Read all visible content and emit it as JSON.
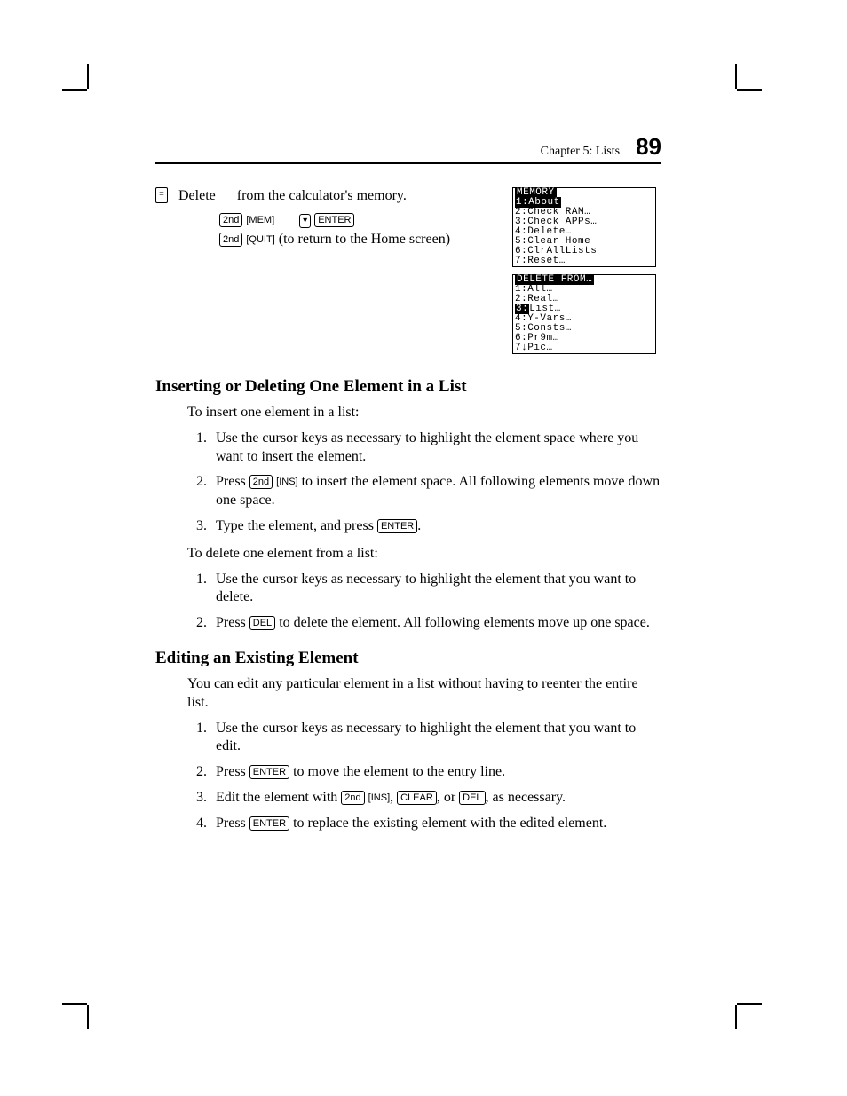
{
  "header": {
    "chapter": "Chapter 5: Lists",
    "page": "89"
  },
  "keys": {
    "second": "2nd",
    "mem": "MEM",
    "down": "▾",
    "enter": "ENTER",
    "quit": "QUIT",
    "ins": "INS",
    "del": "DEL",
    "clear": "CLEAR"
  },
  "topnote": {
    "text_a": "Delete",
    "text_b": "from the calculator's memory.",
    "line2_tail": " (to return to the Home screen)"
  },
  "screen1": {
    "title": "MEMORY",
    "lines": [
      "1:About",
      "2:Check RAM…",
      "3:Check APPs…",
      "4:Delete…",
      "5:Clear Home",
      "6:ClrAllLists",
      "7:Reset…"
    ],
    "sel_index": 0
  },
  "screen2": {
    "title": "DELETE FROM…",
    "lines": [
      "1:All…",
      "2:Real…",
      "3:List…",
      "4:Y-Vars…",
      "5:Consts…",
      "6:Pr9m…",
      "7↓Pic…"
    ],
    "sel_index": 2,
    "sel_label": "3:"
  },
  "h_insert": "Inserting or Deleting One Element in a List",
  "insert_lead": "To insert one element in a list:",
  "insert_steps": {
    "s1": "Use the cursor keys as necessary to highlight the element space where you want to insert the element.",
    "s2_a": "Press ",
    "s2_b": " to insert the element space. All following elements move down one space.",
    "s3_a": "Type the element, and press ",
    "s3_b": "."
  },
  "delete_lead": "To delete one element from a list:",
  "delete_steps": {
    "s1": "Use the cursor keys as necessary to highlight the element that you want to delete.",
    "s2_a": "Press ",
    "s2_b": " to delete the element. All following elements move up one space."
  },
  "h_edit": "Editing an Existing Element",
  "edit_lead": "You can edit any particular element in a list without having to reenter the entire list.",
  "edit_steps": {
    "s1": "Use the cursor keys as necessary to highlight the element that you want to edit.",
    "s2_a": "Press ",
    "s2_b": " to move the element to the entry line.",
    "s3_a": "Edit the element with ",
    "s3_mid": ", ",
    "s3_or": ", or ",
    "s3_b": ", as necessary.",
    "s4_a": "Press ",
    "s4_b": " to replace the existing element with the edited element."
  }
}
